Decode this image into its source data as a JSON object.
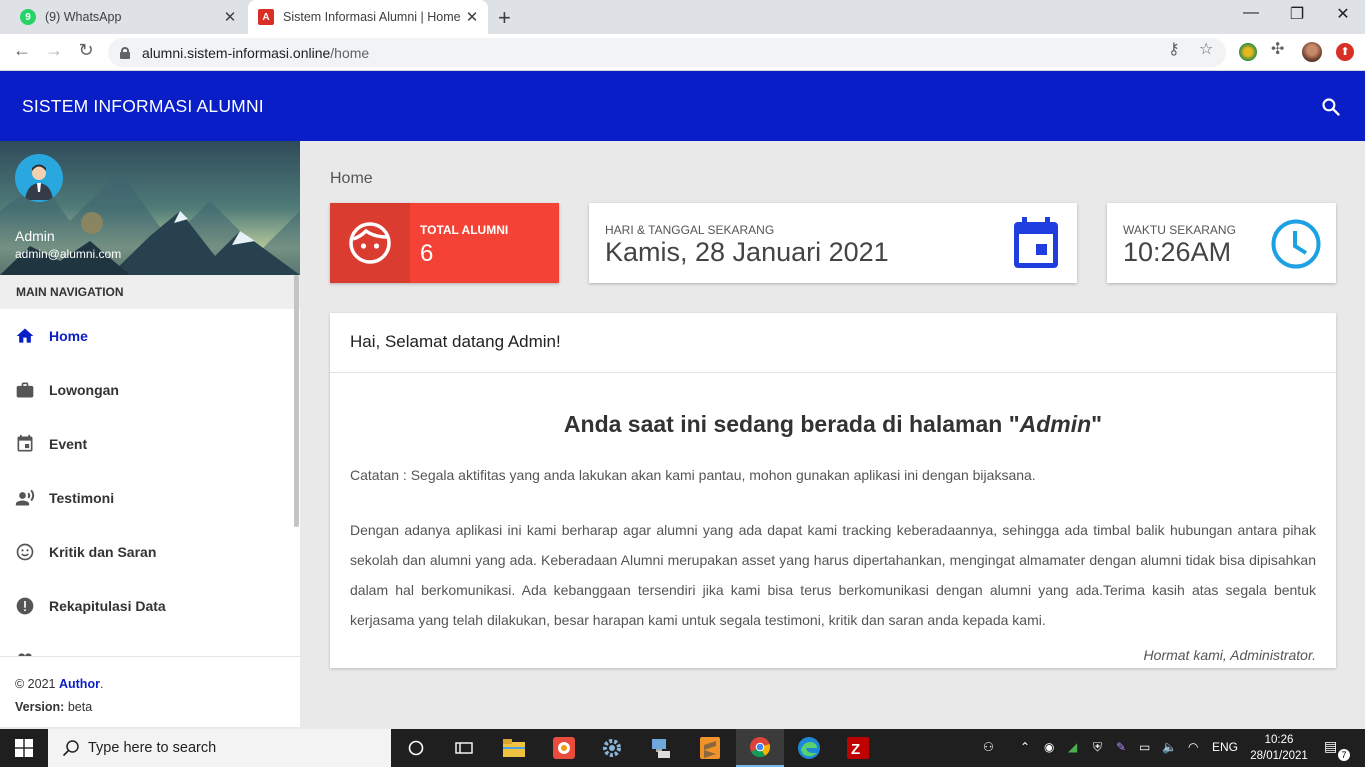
{
  "browser": {
    "tabs": [
      {
        "title": "(9) WhatsApp",
        "favicon": "whatsapp-icon",
        "active": false
      },
      {
        "title": "Sistem Informasi Alumni | Home",
        "favicon": "app-icon",
        "active": true
      }
    ],
    "url_host": "alumni.sistem-informasi.online",
    "url_path": "/home"
  },
  "app": {
    "brand": "SISTEM INFORMASI ALUMNI",
    "header_color": "#0a1ec7"
  },
  "sidebar": {
    "user_name": "Admin",
    "user_email": "admin@alumni.com",
    "nav_header": "MAIN NAVIGATION",
    "items": [
      {
        "label": "Home",
        "icon": "home-icon",
        "active": true
      },
      {
        "label": "Lowongan",
        "icon": "briefcase-icon",
        "active": false
      },
      {
        "label": "Event",
        "icon": "calendar-icon",
        "active": false
      },
      {
        "label": "Testimoni",
        "icon": "record-voice-icon",
        "active": false
      },
      {
        "label": "Kritik dan Saran",
        "icon": "smiley-icon",
        "active": false
      },
      {
        "label": "Rekapitulasi Data",
        "icon": "alert-icon",
        "active": false
      }
    ],
    "footer_copyright": "© 2021",
    "footer_author": "Author",
    "footer_period": ".",
    "footer_version_label": "Version:",
    "footer_version": "beta"
  },
  "content": {
    "breadcrumb": "Home",
    "total_alumni_label": "TOTAL ALUMNI",
    "total_alumni_value": "6",
    "date_label": "HARI & TANGGAL SEKARANG",
    "date_value": "Kamis, 28 Januari 2021",
    "time_label": "WAKTU SEKARANG",
    "time_value": "10:26AM",
    "welcome": "Hai, Selamat datang Admin!",
    "heading_prefix": "Anda saat ini sedang berada di halaman \"",
    "heading_role": "Admin",
    "heading_suffix": "\"",
    "catatan": "Catatan : Segala aktifitas yang anda lakukan akan kami pantau, mohon gunakan aplikasi ini dengan bijaksana.",
    "paragraph": "Dengan adanya aplikasi ini kami berharap agar alumni yang ada dapat kami tracking keberadaannya, sehingga ada timbal balik hubungan antara pihak sekolah dan alumni yang ada. Keberadaan Alumni merupakan asset yang harus dipertahankan, mengingat almamater dengan alumni tidak bisa dipisahkan dalam hal berkomunikasi. Ada kebanggaan tersendiri jika kami bisa terus berkomunikasi dengan alumni yang ada.Terima kasih atas segala bentuk kerjasama yang telah dilakukan, besar harapan kami untuk segala testimoni, kritik dan saran anda kepada kami.",
    "signature": "Hormat kami, Administrator."
  },
  "taskbar": {
    "search_placeholder": "Type here to search",
    "language": "ENG",
    "time": "10:26",
    "date": "28/01/2021",
    "notification_count": "7"
  }
}
